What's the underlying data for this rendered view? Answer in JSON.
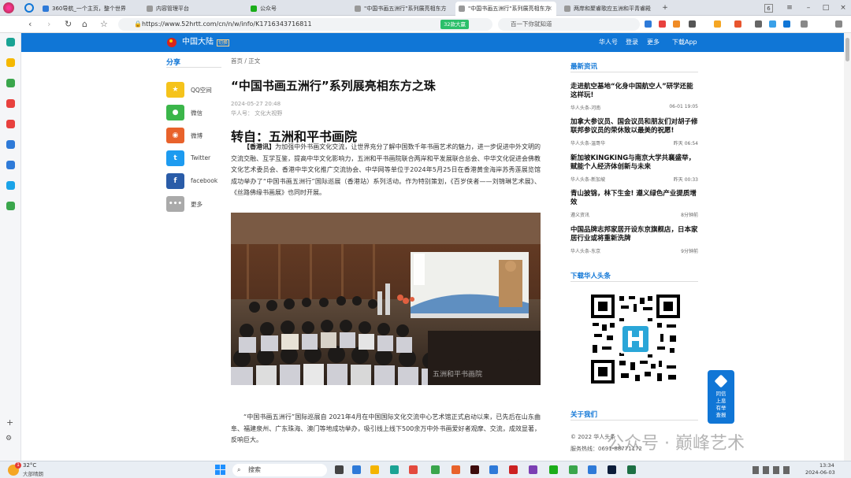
{
  "browser": {
    "tabs": [
      {
        "label": "360导航_一个主页，整个世界",
        "color": "#2e7ad8"
      },
      {
        "label": "内容管理平台",
        "color": "#999"
      },
      {
        "label": "公众号",
        "color": "#1aad19"
      },
      {
        "label": "\"中国书画五洲行\"系列展亮相东方",
        "color": "#999"
      },
      {
        "label": "\"中国书画五洲行\"系列展亮相东方",
        "color": "#999"
      },
      {
        "label": "两岸和聚睿歌应五洲和平青睿殿",
        "color": "#999"
      }
    ],
    "new_tab": "+",
    "tab_count": "6",
    "url": "https://www.52hrtt.com/cn/n/w/info/K1716343716811",
    "url_ad": "32款大赢",
    "search_placeholder": "百一下你就知道"
  },
  "site": {
    "region": "中国大陆",
    "region_badge": "切换",
    "links": [
      "华人号",
      "登录",
      "更多",
      "下载App"
    ]
  },
  "share": {
    "title": "分享",
    "items": [
      {
        "label": "QQ空间",
        "icon": "qzone-icon",
        "color": "#f5c31b"
      },
      {
        "label": "微信",
        "icon": "wechat-icon",
        "color": "#3bb64a"
      },
      {
        "label": "微博",
        "icon": "weibo-icon",
        "color": "#e8622b"
      },
      {
        "label": "Twitter",
        "icon": "twitter-icon",
        "color": "#1d9bf0"
      },
      {
        "label": "facebook",
        "icon": "facebook-icon",
        "color": "#2a5ca8"
      },
      {
        "label": "更多",
        "icon": "more-icon",
        "color": "#aaaaaa"
      }
    ]
  },
  "article": {
    "breadcrumb": "首页 / 正文",
    "title": "“中国书画五洲行”系列展亮相东方之珠",
    "date": "2024-05-27 20:48",
    "author": "华人号： 文化大视野",
    "subhead": "转自：五洲和平书画院",
    "lead_bold": "【香港讯】",
    "lead": "为加强中外书画文化交流，让世界充分了解中国数千年书画艺术的魅力，进一步促进中外文明的交流交融、互学互鉴，提高中华文化影响力，五洲和平书画院联合两岸和平发展联合总会、中华文化促进会佛教文化艺术委员会、香港中华文化推广交流协会、中华网等单位于2024年5月25日在香港黄金海岸苏秀莲展览馆成功举办了“中国书画五洲行”国际巡展（香港站）系列活动。作为特别策划，《百岁侠者——刘锦琳艺术展》、《丝路佛缘书画展》也同时开展。",
    "photo_watermark": "五洲和平书画院",
    "second": "“中国书画五洲行”国际巡展自 2021年4月在中国国际文化交流中心艺术馆正式启动以来，已先后在山东曲阜、福建泉州、广东珠海、澳门等地成功举办，吸引线上线下500余万中外书画爱好者观摩、交流，成效显著，反响巨大。"
  },
  "sidebar": {
    "latest_title": "最新资讯",
    "news": [
      {
        "title": "走进航空基地“化身中国航空人”研学还能这样玩!",
        "source": "华人头条-河南",
        "time": "06-01 19:05"
      },
      {
        "title": "加拿大参议员、国会议员和朋友们对胡子修联邦参议员的荣休致以最美的祝愿!",
        "source": "华人头条-温哥华",
        "time": "昨天 06:54"
      },
      {
        "title": "新加坡KINGKING与南京大学共襄盛举，赋能个人经济体创新与未来",
        "source": "华人头条-新加坡",
        "time": "昨天 00:33"
      },
      {
        "title": "青山披锦，林下生金! 遵义绿色产业提质增效",
        "source": "遵义资讯",
        "time": "8分钟前"
      },
      {
        "title": "中国品牌志邦家居开设东京旗舰店，日本家居行业或将重新洗牌",
        "source": "华人头条-东京",
        "time": "9分钟前"
      }
    ],
    "download_title": "下载华人头条",
    "about_title": "关于我们",
    "about_lines": [
      "© 2022 华人头条",
      "服务热线：0691-88771172"
    ]
  },
  "float_button": "同信上息有举查报",
  "watermark": "公众号 · 巅峰艺术",
  "taskbar": {
    "weather_temp": "32°C",
    "weather_desc": "大部晴朗",
    "weather_badge": "1",
    "search_label": "搜索",
    "time": "13:34",
    "date": "2024-06-03"
  }
}
